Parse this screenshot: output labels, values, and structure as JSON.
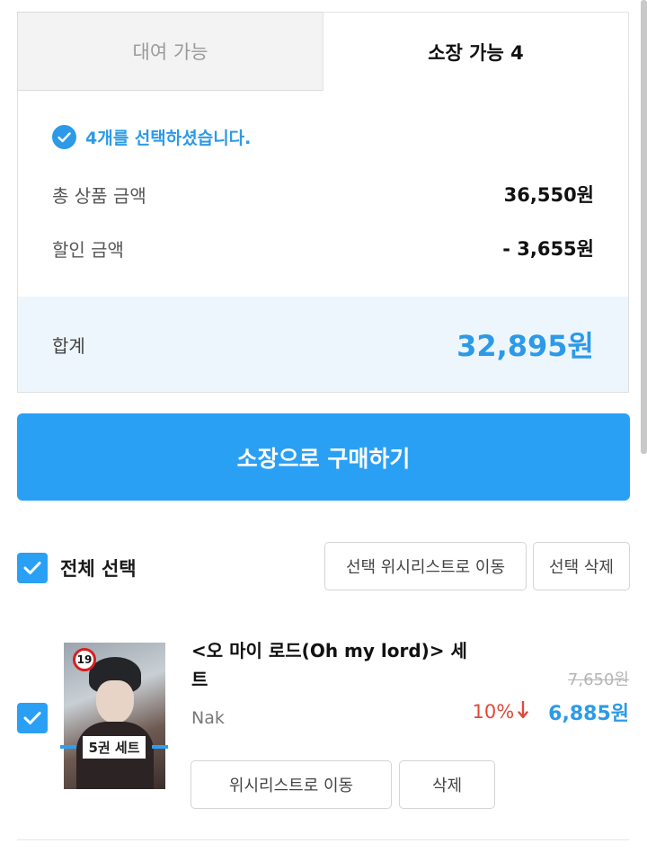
{
  "tabs": {
    "rent_label": "대여 가능",
    "own_label": "소장 가능 4"
  },
  "summary": {
    "selected_message": "4개를 선택하셨습니다.",
    "total_label": "총 상품 금액",
    "total_value": "36,550원",
    "discount_label": "할인 금액",
    "discount_value": "- 3,655원",
    "sum_label": "합계",
    "sum_value": "32,895원"
  },
  "buy_button": "소장으로 구매하기",
  "toolbar": {
    "select_all_label": "전체 선택",
    "move_wishlist_label": "선택 위시리스트로 이동",
    "delete_selected_label": "선택 삭제"
  },
  "item": {
    "title": "<오 마이 로드(Oh my lord)> 세트",
    "author": "Nak",
    "age_rating": "19",
    "set_badge": "5권 세트",
    "original_price": "7,650원",
    "discount_rate": "10%",
    "sale_price": "6,885원",
    "wishlist_button": "위시리스트로 이동",
    "delete_button": "삭제",
    "checked": true
  },
  "colors": {
    "accent": "#2aa0f5",
    "accent_text": "#2c9ae8",
    "discount": "#e04a3c",
    "total_band": "#eef6fd"
  },
  "icons": {
    "selected_message": "check-circle-icon",
    "select_all": "checkbox-checked-icon",
    "item_checkbox": "checkbox-checked-icon",
    "discount_arrow": "arrow-down-icon"
  }
}
